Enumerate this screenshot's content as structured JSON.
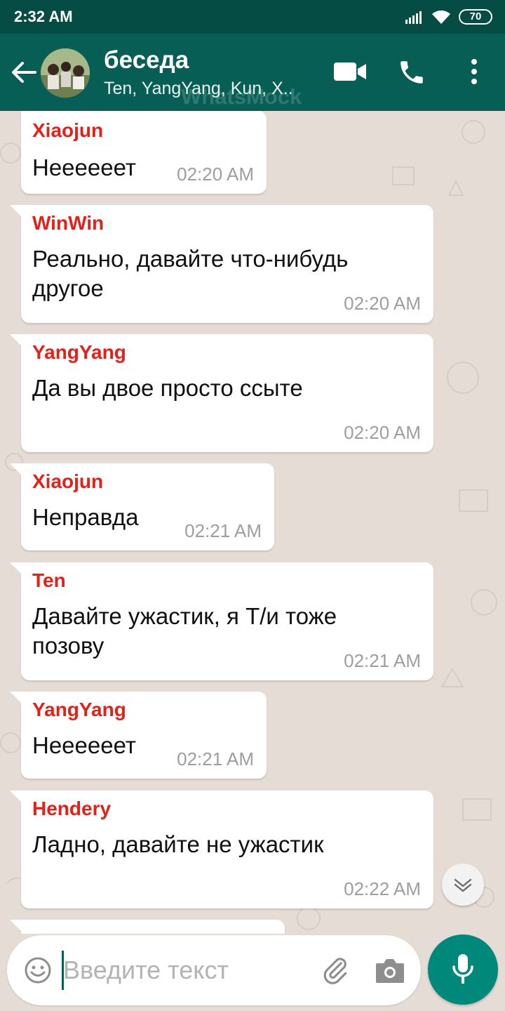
{
  "status_bar": {
    "time": "2:32 AM",
    "battery": "70"
  },
  "header": {
    "title": "беседа",
    "subtitle": "Ten, YangYang, Kun, X..",
    "watermark": "WhatsMock"
  },
  "messages": [
    {
      "sender": "Xiaojun",
      "lines": [
        "Неееееет"
      ],
      "time": "02:20 AM"
    },
    {
      "sender": "WinWin",
      "lines": [
        "Реально, давайте что-нибудь",
        "другое"
      ],
      "time": "02:20 AM"
    },
    {
      "sender": "YangYang",
      "lines": [
        "Да вы двое просто ссыте"
      ],
      "time": "02:20 AM"
    },
    {
      "sender": "Xiaojun",
      "lines": [
        "Неправда"
      ],
      "time": "02:21 AM"
    },
    {
      "sender": "Ten",
      "lines": [
        "Давайте ужастик, я Т/и тоже",
        "позову"
      ],
      "time": "02:21 AM"
    },
    {
      "sender": "YangYang",
      "lines": [
        "Неееееет"
      ],
      "time": "02:21 AM"
    },
    {
      "sender": "Hendery",
      "lines": [
        "Ладно, давайте не ужастик"
      ],
      "time": "02:22 AM"
    }
  ],
  "composer": {
    "placeholder": "Введите текст"
  },
  "colors": {
    "header": "#075e54",
    "status_bar": "#054d44",
    "sender_name": "#e32119",
    "mic_button": "#00897b",
    "chat_background": "#e5ddd5"
  },
  "icons": [
    "back-arrow-icon",
    "video-call-icon",
    "phone-icon",
    "more-vert-icon",
    "chevron-down-icon",
    "emoji-icon",
    "paperclip-icon",
    "camera-icon",
    "mic-icon"
  ]
}
